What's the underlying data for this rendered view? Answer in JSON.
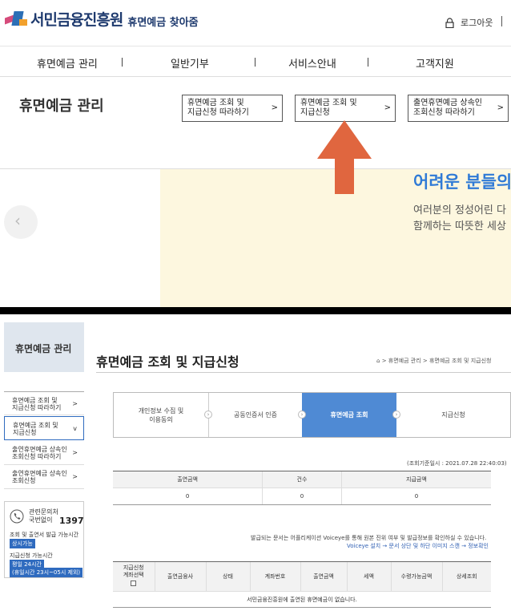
{
  "header": {
    "logo_text": "서민금융진흥원",
    "logo_sub": "휴면예금 찾아줌",
    "login_label": "로그아웃"
  },
  "gnb": {
    "items": [
      "휴면예금 관리",
      "일반기부",
      "서비스안내",
      "고객지원"
    ]
  },
  "sub_nav": {
    "title": "휴면예금 관리",
    "links": [
      {
        "line1": "휴면예금 조회 및",
        "line2": "지급신청 따라하기",
        "arrow": ">"
      },
      {
        "line1": "휴면예금 조회 및",
        "line2": "지급신청",
        "arrow": ">"
      },
      {
        "line1": "출연휴면예금 상속인",
        "line2": "조회신청 따라하기",
        "arrow": ">"
      }
    ]
  },
  "banner": {
    "headline": "어려운 분들의",
    "line1": "여러분의 정성어린 다",
    "line2": "함께하는 따뜻한 세상",
    "prev_arrow": "‹"
  },
  "lnb": {
    "title": "휴면예금 관리",
    "items": [
      {
        "line1": "휴면예금 조회 및",
        "line2": "지급신청 따라하기",
        "arrow": ">"
      },
      {
        "line1": "휴면예금 조회 및",
        "line2": "지급신청",
        "arrow": "v"
      },
      {
        "line1": "출연휴면예금 상속인",
        "line2": "조회신청 따라하기",
        "arrow": ">"
      },
      {
        "line1": "출연휴면예금 상속인",
        "line2": "조회신청",
        "arrow": ">"
      }
    ]
  },
  "contact": {
    "label1": "관련문의처",
    "label2": "국번없이",
    "number": "1397",
    "hours1_label": "조회 및 출연서 발급 가능시간",
    "hours1_badge": "상시가능",
    "hours2_label": "지급신청 가능시간",
    "hours2_badge1": "평일 24시간",
    "hours2_badge2": "(휴일시간 23시~05시 제외)"
  },
  "page": {
    "title": "휴면예금 조회 및 지급신청",
    "home_icon": "⌂",
    "crumb": "> 휴면예금 관리  > 휴면예금 조회 및 지급신청"
  },
  "steps": [
    {
      "line1": "개인정보 수집 및",
      "line2": "이용동의",
      "active": false
    },
    {
      "line1": "공동인증서 인증",
      "line2": "",
      "active": false
    },
    {
      "line1": "휴면예금 조회",
      "line2": "",
      "active": true
    },
    {
      "line1": "지급신청",
      "line2": "",
      "active": false
    }
  ],
  "summary": {
    "timestamp": "(조회기준일시 : 2021.07.28 22:40:03)",
    "headers": [
      "출연금액",
      "건수",
      "지급금액"
    ],
    "values": [
      "0",
      "0",
      "0"
    ]
  },
  "notices": {
    "line1": "발급되는 문서는 어플리케이션 Voiceye를 통해 원본 진위 여부 및 발급정보를 확인하실 수 있습니다.",
    "line2": "Voiceye 설치 → 문서 상단 및 하단 이미지 스캔 → 정보확인"
  },
  "list": {
    "headers": [
      "지급신청\n계좌선택",
      "출연금융사",
      "상태",
      "계좌번호",
      "출연금액",
      "세액",
      "수령가능금액",
      "상세조회"
    ],
    "empty_message": "서민금융진흥원에 출연된 휴면예금이 없습니다."
  },
  "colors": {
    "brand_navy": "#1e3a6e",
    "active_blue": "#4f8ad4",
    "annotation_arrow": "#e0663f"
  }
}
